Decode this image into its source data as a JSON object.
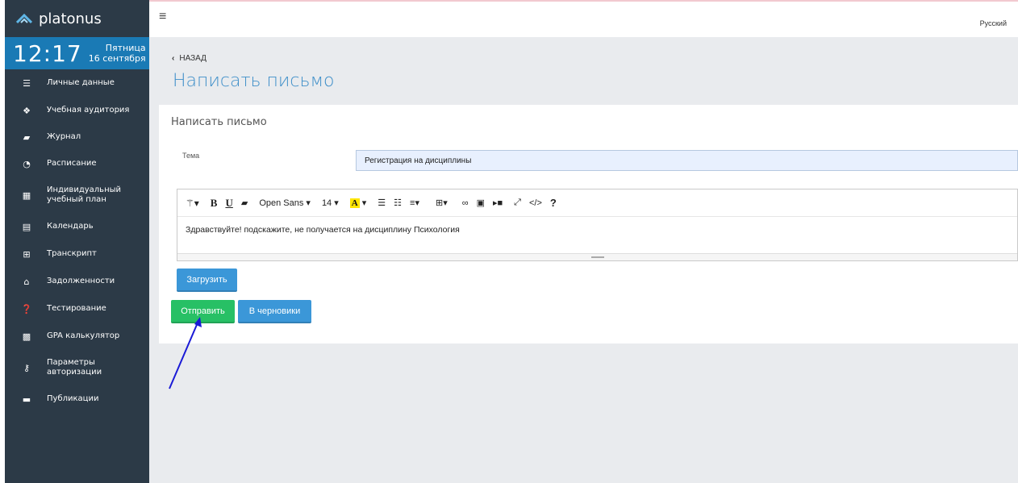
{
  "brand": {
    "name": "platonus"
  },
  "clock": {
    "time": "12:17",
    "weekday": "Пятница",
    "date": "16 сентября"
  },
  "sidebar": {
    "items": [
      {
        "label": "Личные данные",
        "icon": "list-icon"
      },
      {
        "label": "Учебная аудитория",
        "icon": "cubes-icon"
      },
      {
        "label": "Журнал",
        "icon": "book-icon"
      },
      {
        "label": "Расписание",
        "icon": "clock-icon"
      },
      {
        "label": "Индивидуальный учебный план",
        "icon": "grid-icon"
      },
      {
        "label": "Календарь",
        "icon": "calendar-icon"
      },
      {
        "label": "Транскрипт",
        "icon": "table-icon"
      },
      {
        "label": "Задолженности",
        "icon": "inbox-icon"
      },
      {
        "label": "Тестирование",
        "icon": "question-icon"
      },
      {
        "label": "GPA калькулятор",
        "icon": "calculator-icon"
      },
      {
        "label": "Параметры авторизации",
        "icon": "key-icon"
      },
      {
        "label": "Публикации",
        "icon": "folder-icon"
      }
    ]
  },
  "topbar": {
    "language": "Русский"
  },
  "main": {
    "back_label": "НАЗАД",
    "page_title": "Написать письмо",
    "card_title": "Написать письмо",
    "subject_label": "Тема",
    "subject_value": "Регистрация на дисциплины",
    "editor": {
      "font_name": "Open Sans",
      "font_size": "14",
      "content": "Здравствуйте! подскажите, не получается на дисциплину  Психология"
    },
    "upload_label": "Загрузить",
    "send_label": "Отправить",
    "draft_label": "В черновики"
  },
  "colors": {
    "sidebar": "#2c3a47",
    "clock": "#1a7ab5",
    "title": "#3f8fc9",
    "send": "#27c065",
    "primary": "#3b97d8",
    "annotation_arrow": "#1a1ad6"
  }
}
